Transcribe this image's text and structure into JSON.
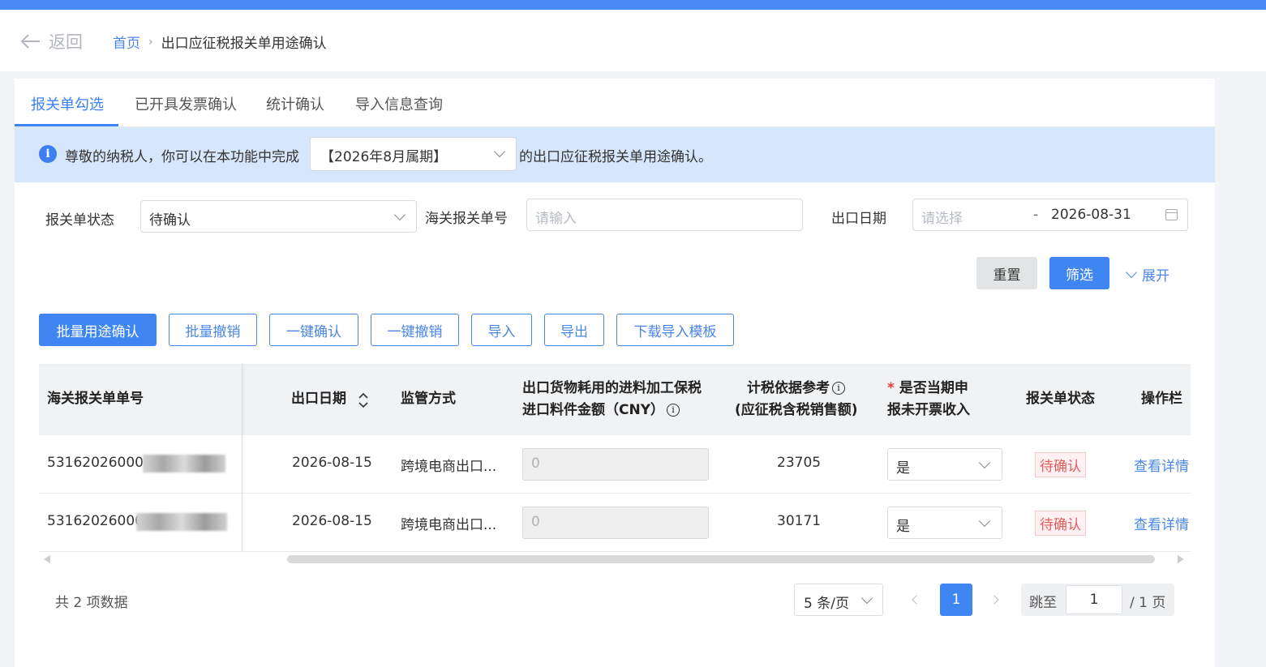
{
  "header": {
    "back_label": "返回",
    "breadcrumb_home": "首页",
    "breadcrumb_sep": "›",
    "breadcrumb_current": "出口应征税报关单用途确认"
  },
  "tabs": [
    {
      "label": "报关单勾选",
      "active": true
    },
    {
      "label": "已开具发票确认",
      "active": false
    },
    {
      "label": "统计确认",
      "active": false
    },
    {
      "label": "导入信息查询",
      "active": false
    }
  ],
  "notice": {
    "prefix": "尊敬的纳税人，你可以在本功能中完成",
    "period_value": "【2026年8月属期】",
    "suffix": "的出口应征税报关单用途确认。"
  },
  "filters": {
    "status_label": "报关单状态",
    "status_value": "待确认",
    "customs_no_label": "海关报关单号",
    "customs_no_placeholder": "请输入",
    "date_label": "出口日期",
    "date_start_placeholder": "请选择",
    "date_sep": "-",
    "date_end_value": "2026-08-31",
    "reset_label": "重置",
    "filter_label": "筛选",
    "expand_label": "展开"
  },
  "toolbar": {
    "batch_confirm": "批量用途确认",
    "batch_cancel": "批量撤销",
    "one_click_confirm": "一键确认",
    "one_click_cancel": "一键撤销",
    "import": "导入",
    "export": "导出",
    "download_template": "下载导入模板"
  },
  "table": {
    "columns": {
      "customs_no": "海关报关单单号",
      "export_date": "出口日期",
      "supervision": "监管方式",
      "material_line1": "出口货物耗用的进料加工保税",
      "material_line2": "进口料件金额（CNY）",
      "tax_basis_line1": "计税依据参考",
      "tax_basis_line2": "(应征税含税销售额)",
      "declare_line1": "是否当期申",
      "declare_line2": "报未开票收入",
      "declare_required": "*",
      "status": "报关单状态",
      "action": "操作栏"
    },
    "rows": [
      {
        "customs_no": "531620260003",
        "export_date": "2026-08-15",
        "supervision": "跨境电商出口...",
        "material_amount": "0",
        "tax_basis": "23705",
        "declare": "是",
        "status": "待确认",
        "action": "查看详情"
      },
      {
        "customs_no": "53162026000",
        "export_date": "2026-08-15",
        "supervision": "跨境电商出口...",
        "material_amount": "0",
        "tax_basis": "30171",
        "declare": "是",
        "status": "待确认",
        "action": "查看详情"
      }
    ]
  },
  "pagination": {
    "total_text": "共 2 项数据",
    "page_size": "5 条/页",
    "current_page": "1",
    "jump_label": "跳至",
    "jump_value": "1",
    "total_pages": "/ 1 页"
  },
  "colors": {
    "accent": "#3f86f2",
    "top_bar": "#4a8af4",
    "notice_bg": "#d6e6fb",
    "status_red": "#e65a5a"
  }
}
